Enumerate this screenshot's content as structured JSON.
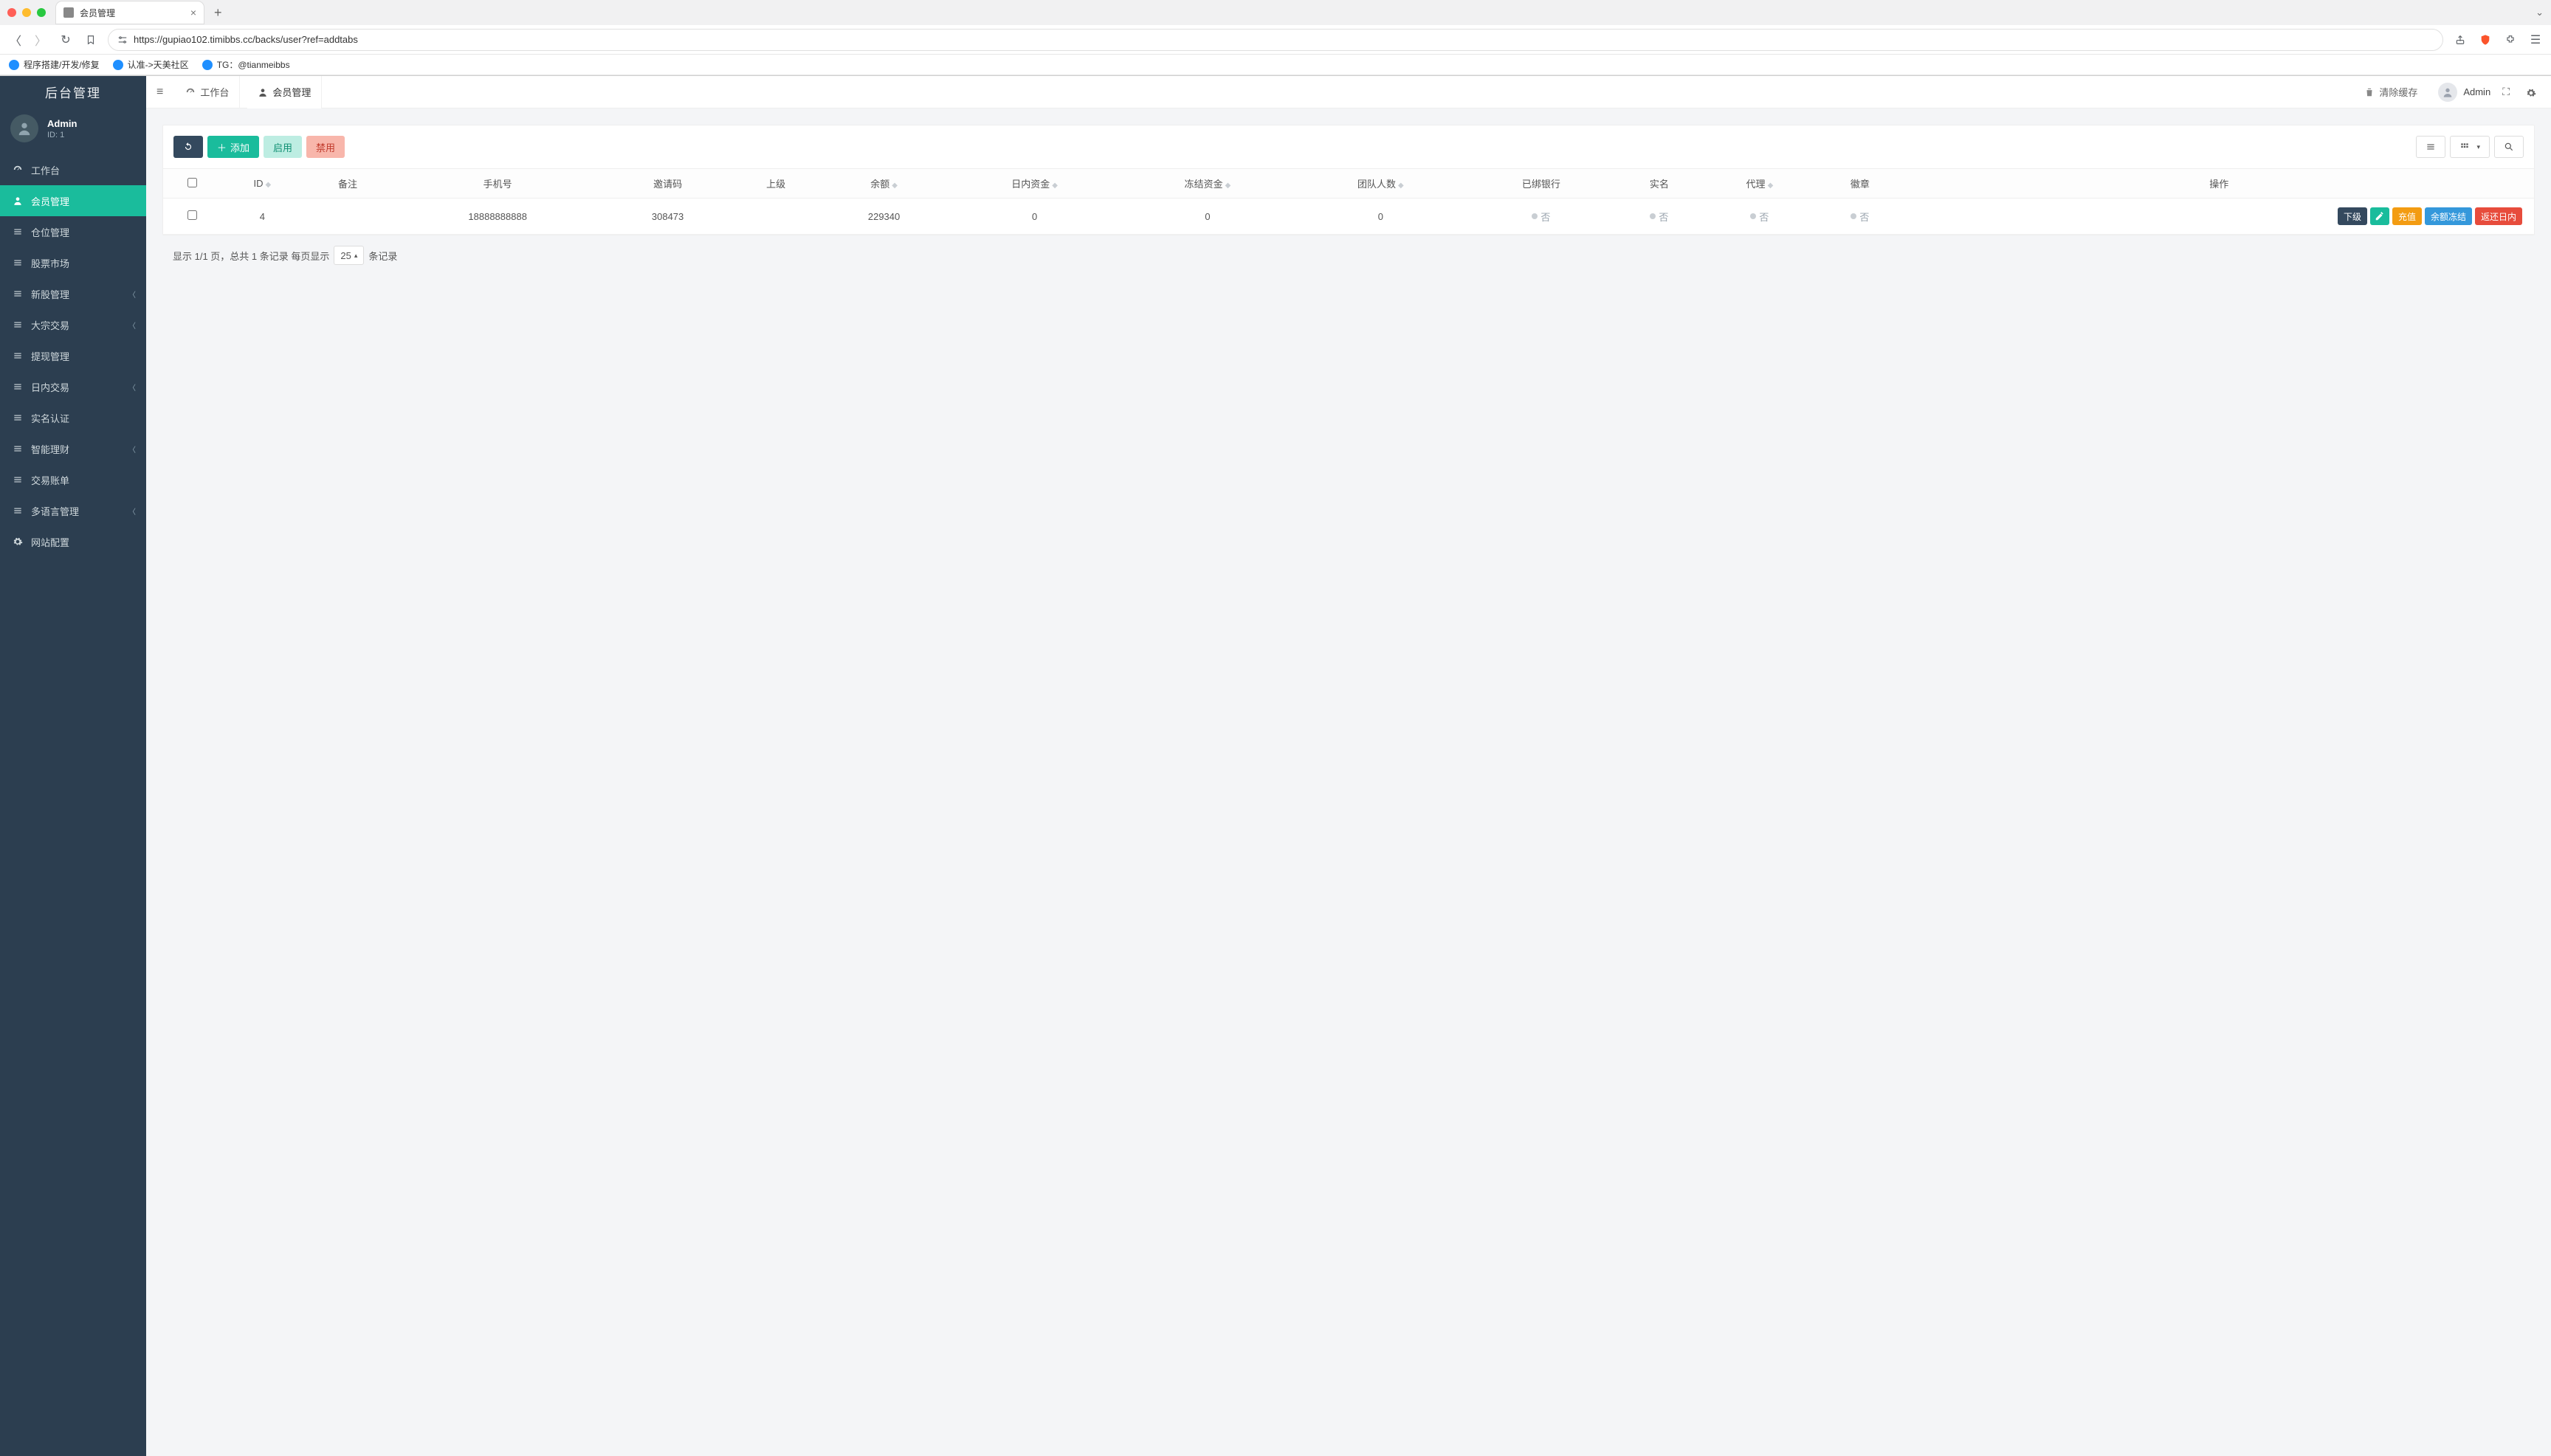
{
  "browser": {
    "tab_title": "会员管理",
    "url": "https://gupiao102.timibbs.cc/backs/user?ref=addtabs",
    "bookmarks": [
      "程序搭建/开发/修复",
      "认准->天美社区",
      "TG：@tianmeibbs"
    ]
  },
  "sidebar": {
    "brand": "后台管理",
    "user": {
      "name": "Admin",
      "id_label": "ID: 1"
    },
    "items": [
      {
        "label": "工作台",
        "icon": "dashboard",
        "expandable": false,
        "active": false
      },
      {
        "label": "会员管理",
        "icon": "user",
        "expandable": false,
        "active": true
      },
      {
        "label": "仓位管理",
        "icon": "list",
        "expandable": false,
        "active": false
      },
      {
        "label": "股票市场",
        "icon": "list",
        "expandable": false,
        "active": false
      },
      {
        "label": "新股管理",
        "icon": "list",
        "expandable": true,
        "active": false
      },
      {
        "label": "大宗交易",
        "icon": "list",
        "expandable": true,
        "active": false
      },
      {
        "label": "提现管理",
        "icon": "list",
        "expandable": false,
        "active": false
      },
      {
        "label": "日内交易",
        "icon": "list",
        "expandable": true,
        "active": false
      },
      {
        "label": "实名认证",
        "icon": "list",
        "expandable": false,
        "active": false
      },
      {
        "label": "智能理财",
        "icon": "list",
        "expandable": true,
        "active": false
      },
      {
        "label": "交易账单",
        "icon": "list",
        "expandable": false,
        "active": false
      },
      {
        "label": "多语言管理",
        "icon": "list",
        "expandable": true,
        "active": false
      },
      {
        "label": "网站配置",
        "icon": "gear",
        "expandable": false,
        "active": false
      }
    ]
  },
  "topbar": {
    "tabs": [
      {
        "label": "工作台",
        "icon": "dashboard"
      },
      {
        "label": "会员管理",
        "icon": "user",
        "active": true
      }
    ],
    "clear_cache": "清除缓存",
    "user_name": "Admin"
  },
  "toolbar": {
    "refresh_title": "刷新",
    "add": "添加",
    "enable": "启用",
    "disable": "禁用"
  },
  "table": {
    "columns": [
      "",
      "ID",
      "备注",
      "手机号",
      "邀请码",
      "上级",
      "余额",
      "日内资金",
      "冻结资金",
      "团队人数",
      "已绑银行",
      "实名",
      "代理",
      "徽章",
      "操作"
    ],
    "sortable_cols": [
      "ID",
      "余额",
      "日内资金",
      "冻结资金",
      "团队人数",
      "代理"
    ],
    "status_no": "否",
    "rows": [
      {
        "id": "4",
        "remark": "",
        "phone": "18888888888",
        "invite_code": "308473",
        "parent": "",
        "balance": "229340",
        "intraday": "0",
        "frozen": "0",
        "team": "0",
        "bank": "否",
        "realname": "否",
        "agent": "否",
        "badge": "否"
      }
    ],
    "ops": {
      "sub": "下级",
      "edit": "✎",
      "recharge": "充值",
      "freeze": "余额冻结",
      "return": "返还日内"
    }
  },
  "pager": {
    "prefix": "显示 1/1 页，总共 1 条记录  每页显示",
    "size": "25",
    "suffix": "条记录"
  }
}
